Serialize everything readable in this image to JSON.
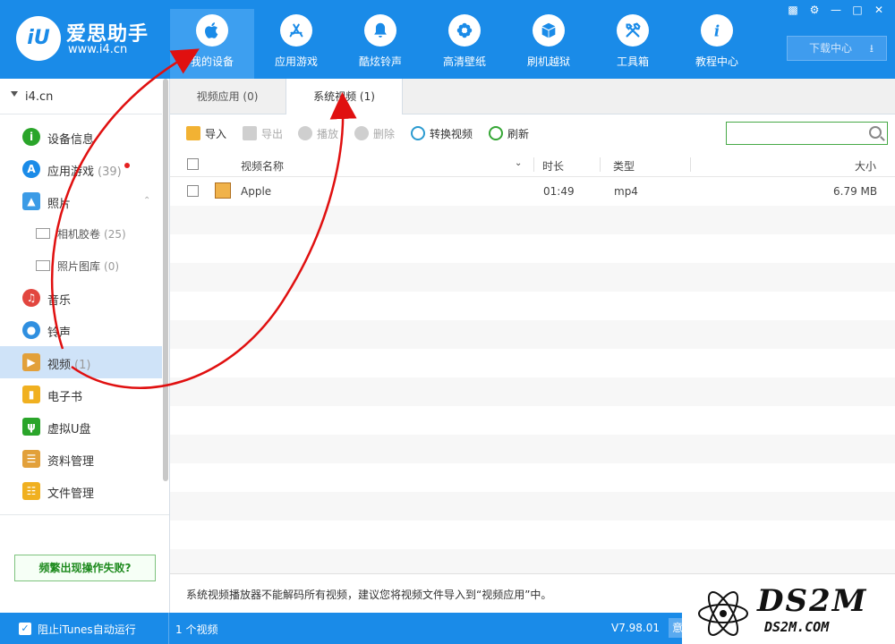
{
  "header": {
    "brand_name": "爱思助手",
    "brand_url": "www.i4.cn",
    "logo_text": "iU",
    "nav": [
      {
        "label": "我的设备",
        "icon": "apple-icon"
      },
      {
        "label": "应用游戏",
        "icon": "app-store-icon"
      },
      {
        "label": "酷炫铃声",
        "icon": "bell-icon"
      },
      {
        "label": "高清壁纸",
        "icon": "flower-icon"
      },
      {
        "label": "刷机越狱",
        "icon": "box-icon"
      },
      {
        "label": "工具箱",
        "icon": "tools-icon"
      },
      {
        "label": "教程中心",
        "icon": "info-icon"
      }
    ],
    "download_label": "下载中心",
    "window_controls": [
      "shirt-icon",
      "gear-icon",
      "minimize-icon",
      "maximize-icon",
      "close-icon"
    ]
  },
  "sidebar": {
    "device_name": "i4.cn",
    "items": [
      {
        "label": "设备信息",
        "count": "",
        "icon": "info-icon",
        "color": "#2aa52a"
      },
      {
        "label": "应用游戏",
        "count": "(39)",
        "icon": "app-store-icon",
        "color": "#1a8be8"
      },
      {
        "label": "照片",
        "count": "",
        "icon": "photo-icon",
        "color": "#3b9be6"
      },
      {
        "label": "相机胶卷",
        "count": "(25)"
      },
      {
        "label": "照片图库",
        "count": "(0)"
      },
      {
        "label": "音乐",
        "count": "",
        "icon": "music-icon",
        "color": "#e2463f"
      },
      {
        "label": "铃声",
        "count": "",
        "icon": "bell-icon",
        "color": "#2f8fe0"
      },
      {
        "label": "视频",
        "count": "(1)",
        "icon": "film-icon",
        "color": "#e2a03a"
      },
      {
        "label": "电子书",
        "count": "",
        "icon": "book-icon",
        "color": "#f0b020"
      },
      {
        "label": "虚拟U盘",
        "count": "",
        "icon": "usb-icon",
        "color": "#2aa52a"
      },
      {
        "label": "资料管理",
        "count": "",
        "icon": "contacts-icon",
        "color": "#e2a03a"
      },
      {
        "label": "文件管理",
        "count": "",
        "icon": "folder-icon",
        "color": "#f0b020"
      }
    ],
    "help_button": "频繁出现操作失败?"
  },
  "main": {
    "tabs": [
      {
        "label": "视频应用 (0)"
      },
      {
        "label": "系统视频 (1)"
      }
    ],
    "toolbar": {
      "import": "导入",
      "export": "导出",
      "play": "播放",
      "delete": "删除",
      "convert": "转换视频",
      "refresh": "刷新"
    },
    "search_placeholder": "",
    "columns": {
      "name": "视频名称",
      "duration": "时长",
      "type": "类型",
      "size": "大小"
    },
    "rows": [
      {
        "name": "Apple",
        "duration": "01:49",
        "type": "mp4",
        "size": "6.79 MB"
      }
    ],
    "notice": "系统视频播放器不能解码所有视频，建议您将视频文件导入到“视频应用”中。"
  },
  "statusbar": {
    "itunes_label": "阻止iTunes自动运行",
    "video_count": "1 个视频",
    "version": "V7.98.01",
    "right_button": "意"
  },
  "watermark": {
    "main": "DS2M",
    "url": "DS2M.COM"
  }
}
